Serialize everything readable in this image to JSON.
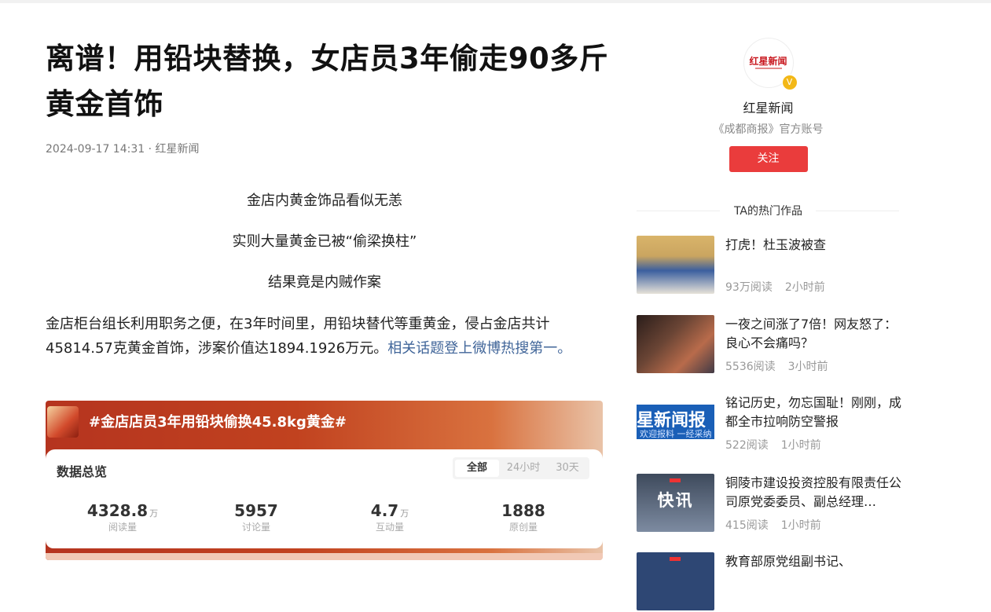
{
  "article": {
    "title": "离谱！用铅块替换，女店员3年偷走90多斤黄金首饰",
    "meta": "2024-09-17 14:31 · 红星新闻",
    "lines": [
      "金店内黄金饰品看似无恙",
      "实则大量黄金已被“偷梁换柱”",
      "结果竟是内贼作案"
    ],
    "paragraph": "金店柜台组长利用职务之便，在3年时间里，用铅块替代等重黄金，侵占金店共计45814.57克黄金首饰，涉案价值达1894.1926万元。",
    "paragraph_link": "相关话题登上微博热搜第一。"
  },
  "topic": {
    "title": "#金店店员3年用铅块偷换45.8kg黄金#",
    "overview_label": "数据总览",
    "tabs": [
      "全部",
      "24小时",
      "30天"
    ],
    "active_tab": "全部",
    "stats": [
      {
        "value": "4328.8",
        "unit": "万",
        "label": "阅读量"
      },
      {
        "value": "5957",
        "unit": "",
        "label": "讨论量"
      },
      {
        "value": "4.7",
        "unit": "万",
        "label": "互动量"
      },
      {
        "value": "1888",
        "unit": "",
        "label": "原创量"
      }
    ]
  },
  "author": {
    "logo_text": "红星新闻",
    "badge": "V",
    "name": "红星新闻",
    "desc": "《成都商报》官方账号",
    "follow_label": "关注"
  },
  "hot": {
    "heading": "TA的热门作品",
    "items": [
      {
        "title": "打虎！杜玉波被查",
        "reads": "93万阅读",
        "time": "2小时前"
      },
      {
        "title": "一夜之间涨了7倍！网友怒了：良心不会痛吗？",
        "reads": "5536阅读",
        "time": "3小时前"
      },
      {
        "title": "铭记历史，勿忘国耻！刚刚，成都全市拉响防空警报",
        "reads": "522阅读",
        "time": "1小时前",
        "thumb_text": "星新闻报",
        "thumb_sub": "欢迎报料 一经采纳"
      },
      {
        "title": "铜陵市建设投资控股有限责任公司原党委委员、副总经理…",
        "reads": "415阅读",
        "time": "1小时前",
        "thumb_text": "快讯"
      },
      {
        "title": "教育部原党组副书记、"
      }
    ]
  }
}
